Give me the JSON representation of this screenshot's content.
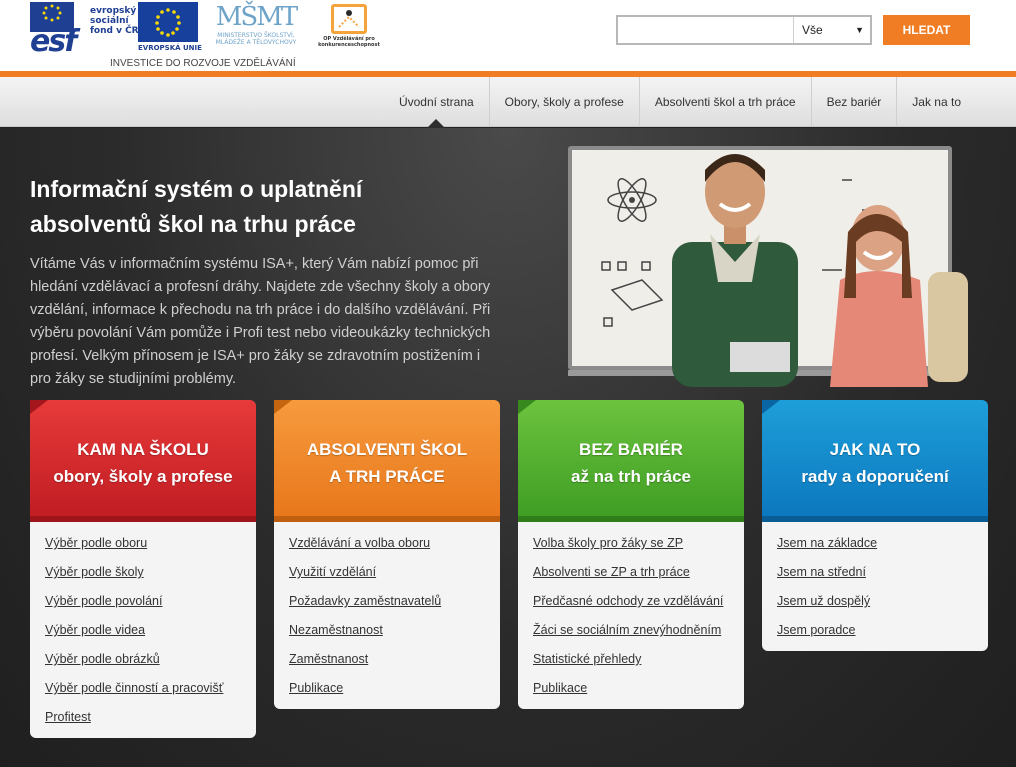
{
  "header": {
    "logos": {
      "esf_mark": "esf",
      "esf_sub": "evropský sociální fond v ČR",
      "eu_label": "EVROPSKÁ UNIE",
      "msmt_mark": "MŠMT",
      "msmt_label": "MINISTERSTVO ŠKOLSTVÍ, MLÁDEŽE A TĚLOVÝCHOVY",
      "op_label": "OP Vzdělávání pro konkurenceschopnost",
      "invest": "INVESTICE DO ROZVOJE VZDĚLÁVÁNÍ"
    },
    "search": {
      "value": "",
      "select_value": "Vše",
      "button_label": "HLEDAT"
    }
  },
  "nav": {
    "items": [
      {
        "label": "Úvodní strana"
      },
      {
        "label": "Obory, školy a profese"
      },
      {
        "label": "Absolventi škol a trh práce"
      },
      {
        "label": "Bez bariér"
      },
      {
        "label": "Jak na to"
      }
    ]
  },
  "hero": {
    "title_line1": "Informační systém o uplatnění",
    "title_line2": "absolventů škol na trhu práce",
    "text": "Vítáme Vás v informačním systému ISA+, který Vám nabízí pomoc při hledání vzdělávací a profesní dráhy. Najdete zde všechny školy a obory vzdělání, informace k přechodu na trh práce i do dalšího vzdělávání. Při výběru povolání Vám pomůže i Profi test nebo videoukázky technických profesí. Velkým přínosem je ISA+ pro žáky se zdravotním postižením i pro žáky se studijními problémy."
  },
  "cards": [
    {
      "title1": "KAM NA ŠKOLU",
      "title2": "obory, školy a profese",
      "links": [
        "Výběr podle oboru",
        "Výběr podle školy",
        "Výběr podle povolání",
        "Výběr podle videa",
        "Výběr podle obrázků",
        "Výběr podle činností a pracovišť",
        "Profitest"
      ]
    },
    {
      "title1": "ABSOLVENTI ŠKOL",
      "title2": "A TRH PRÁCE",
      "links": [
        "Vzdělávání a volba oboru",
        "Využití vzdělání",
        "Požadavky zaměstnavatelů",
        "Nezaměstnanost",
        "Zaměstnanost",
        "Publikace"
      ]
    },
    {
      "title1": "BEZ BARIÉR",
      "title2": "až na trh práce",
      "links": [
        "Volba školy pro žáky se ZP",
        "Absolventi se ZP a trh práce",
        "Předčasné odchody ze vzdělávání",
        "Žáci se sociálním znevýhodněním",
        "Statistické přehledy",
        "Publikace"
      ]
    },
    {
      "title1": "JAK NA TO",
      "title2": "rady a doporučení",
      "links": [
        "Jsem na základce",
        "Jsem na střední",
        "Jsem už dospělý",
        "Jsem poradce"
      ]
    }
  ],
  "colors": {
    "accent": "#f07d24",
    "card_red": "#d32a2f",
    "card_orange": "#f08a2c",
    "card_green": "#52b02f",
    "card_blue": "#148ccc"
  }
}
